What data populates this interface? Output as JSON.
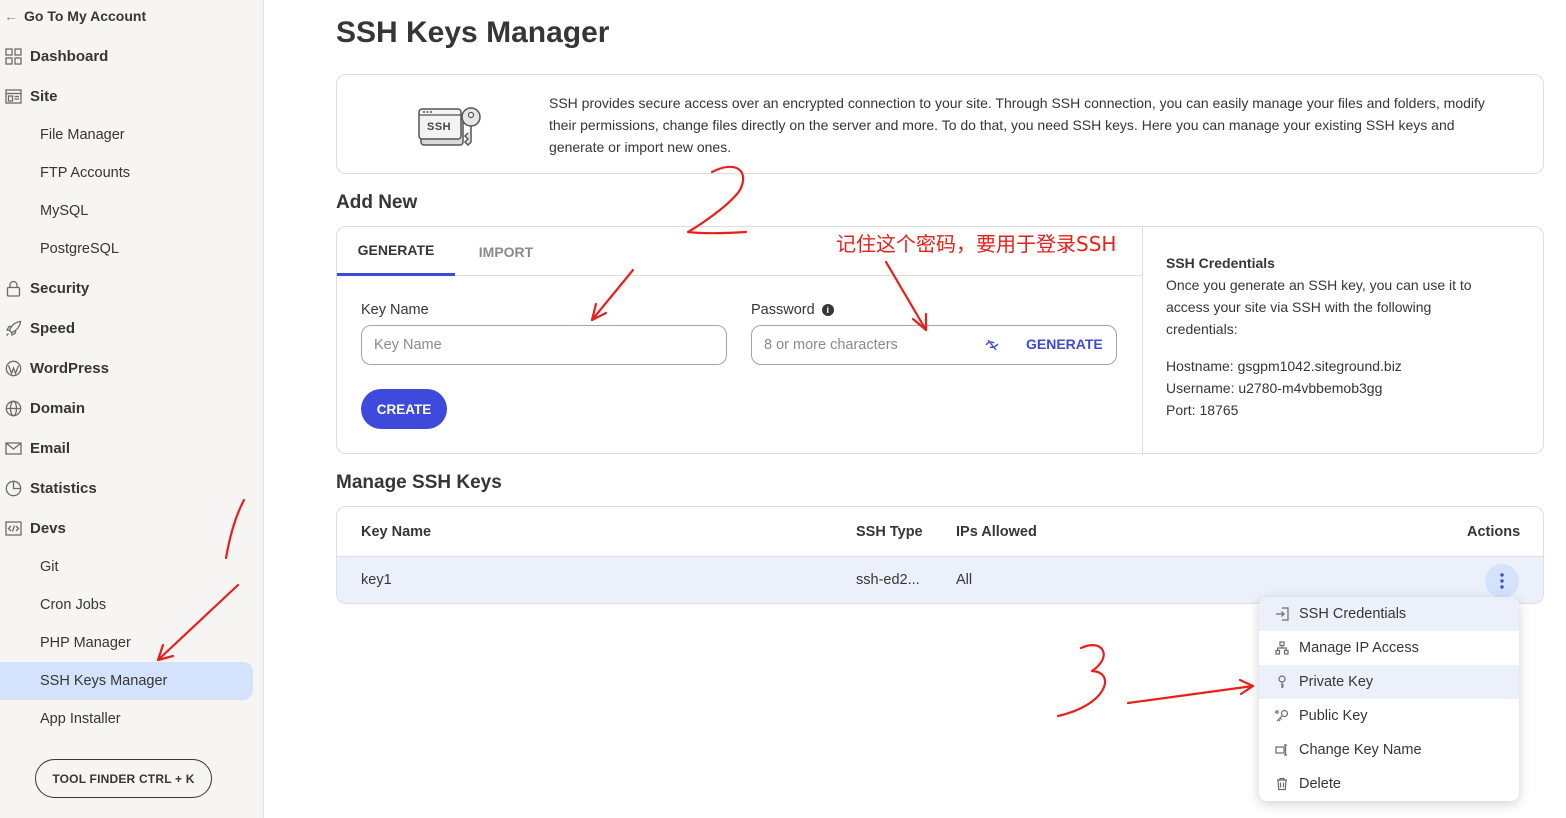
{
  "sidebar": {
    "back_label": "Go To My Account",
    "items": [
      {
        "label": "Dashboard",
        "icon": "grid-icon"
      },
      {
        "label": "Site",
        "icon": "window-icon"
      },
      {
        "label": "File Manager"
      },
      {
        "label": "FTP Accounts"
      },
      {
        "label": "MySQL"
      },
      {
        "label": "PostgreSQL"
      },
      {
        "label": "Security",
        "icon": "lock-icon"
      },
      {
        "label": "Speed",
        "icon": "rocket-icon"
      },
      {
        "label": "WordPress",
        "icon": "wordpress-icon"
      },
      {
        "label": "Domain",
        "icon": "globe-icon"
      },
      {
        "label": "Email",
        "icon": "envelope-icon"
      },
      {
        "label": "Statistics",
        "icon": "pie-chart-icon"
      },
      {
        "label": "Devs",
        "icon": "code-icon"
      },
      {
        "label": "Git"
      },
      {
        "label": "Cron Jobs"
      },
      {
        "label": "PHP Manager"
      },
      {
        "label": "SSH Keys Manager",
        "active": true
      },
      {
        "label": "App Installer"
      }
    ],
    "tool_finder_label": "TOOL FINDER CTRL + K"
  },
  "page": {
    "title": "SSH Keys Manager",
    "intro_badge": "SSH",
    "intro_text": "SSH provides secure access over an encrypted connection to your site. Through SSH connection, you can easily manage your files and folders, modify their permissions, change files directly on the server and more. To do that, you need SSH keys. Here you can manage your existing SSH keys and generate or import new ones."
  },
  "add_new": {
    "title": "Add New",
    "tabs": [
      {
        "label": "GENERATE",
        "active": true
      },
      {
        "label": "IMPORT"
      }
    ],
    "key_name_label": "Key Name",
    "key_name_placeholder": "Key Name",
    "password_label": "Password",
    "password_placeholder": "8 or more characters",
    "generate_label": "GENERATE",
    "create_label": "CREATE",
    "credentials": {
      "title": "SSH Credentials",
      "description": "Once you generate an SSH key, you can use it to access your site via SSH with the following credentials:",
      "hostname": "Hostname: gsgpm1042.siteground.biz",
      "username": "Username: u2780-m4vbbemob3gg",
      "port": "Port: 18765"
    }
  },
  "manage": {
    "title": "Manage SSH Keys",
    "columns": [
      "Key Name",
      "SSH Type",
      "IPs Allowed",
      "Actions"
    ],
    "rows": [
      {
        "key_name": "key1",
        "ssh_type": "ssh-ed2...",
        "ips": "All"
      }
    ]
  },
  "actions_menu": [
    {
      "label": "SSH Credentials",
      "icon": "login-icon"
    },
    {
      "label": "Manage IP Access",
      "icon": "network-icon"
    },
    {
      "label": "Private Key",
      "icon": "key-icon",
      "highlighted": true
    },
    {
      "label": "Public Key",
      "icon": "key-share-icon"
    },
    {
      "label": "Change Key Name",
      "icon": "rename-icon"
    },
    {
      "label": "Delete",
      "icon": "trash-icon"
    }
  ],
  "annotations": {
    "note": "记住这个密码，要用于登录SSH",
    "color": "#e8201a"
  },
  "colors": {
    "accent": "#3d4adb",
    "active_bg": "#d4e3fb",
    "row_bg": "#ecf0fb"
  }
}
